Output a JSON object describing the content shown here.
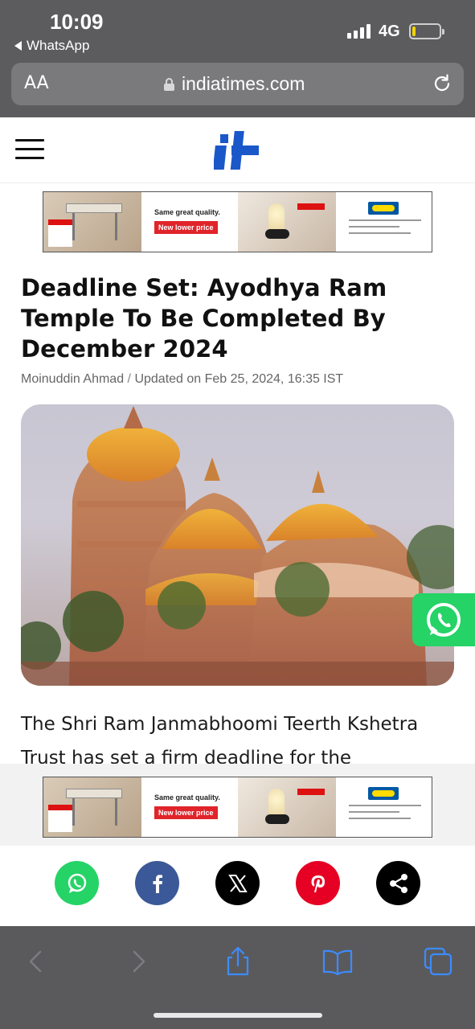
{
  "status": {
    "time": "10:09",
    "back_app": "WhatsApp",
    "network": "4G",
    "battery_level": 0.1
  },
  "browser": {
    "text_size_label": "AA",
    "url": "indiatimes.com"
  },
  "ads": {
    "tagline": "Same great quality.",
    "promo": "New lower price"
  },
  "article": {
    "headline": "Deadline Set: Ayodhya Ram Temple To Be Completed By December 2024",
    "author": "Moinuddin Ahmad",
    "separator": "/",
    "updated": "Updated on Feb 25, 2024, 16:35 IST",
    "body": "The Shri Ram Janmabhoomi Teerth Kshetra Trust has set a firm deadline for the"
  },
  "share": [
    {
      "name": "whatsapp",
      "color": "#25d366"
    },
    {
      "name": "facebook",
      "color": "#3b5998"
    },
    {
      "name": "x",
      "color": "#000000"
    },
    {
      "name": "pinterest",
      "color": "#e60023"
    },
    {
      "name": "share",
      "color": "#000000"
    }
  ],
  "colors": {
    "whatsapp_green": "#25d366",
    "brand_blue": "#1a57c9"
  }
}
